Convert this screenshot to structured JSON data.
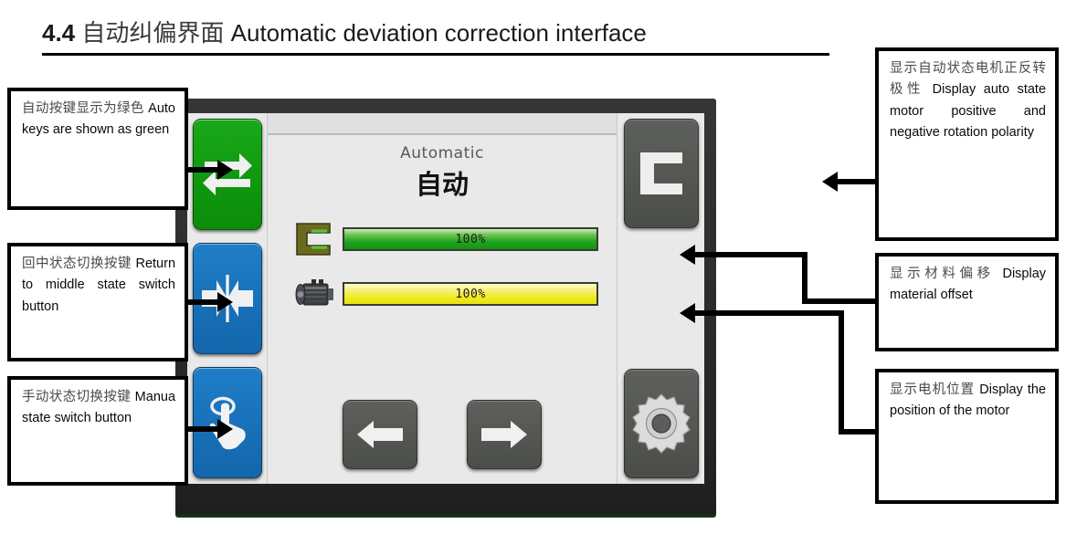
{
  "heading": {
    "number": "4.4",
    "chinese": "自动纠偏界面",
    "english": "Automatic deviation correction interface"
  },
  "hmi": {
    "mode_title_en": "Automatic",
    "mode_title_cn": "自动",
    "gauges": [
      {
        "icon": "fork-sensor-icon",
        "value": "100%",
        "color": "#1fa520",
        "name": "material-offset-gauge"
      },
      {
        "icon": "servo-motor-icon",
        "value": "100%",
        "color": "#eeea1c",
        "name": "motor-position-gauge"
      }
    ],
    "left_buttons": [
      {
        "name": "auto-mode-button",
        "icon": "cycle-arrows-icon",
        "color": "#10980f"
      },
      {
        "name": "return-middle-button",
        "icon": "center-arrows-icon",
        "color": "#1870b8"
      },
      {
        "name": "manual-mode-button",
        "icon": "touch-hand-icon",
        "color": "#1870b8"
      }
    ],
    "right_buttons": [
      {
        "name": "sensor-polarity-button",
        "icon": "fork-sensor-icon",
        "color": "#555753"
      },
      {
        "name": "settings-button",
        "icon": "gear-icon",
        "color": "#555753"
      }
    ],
    "jog_buttons": [
      {
        "name": "jog-left-button",
        "icon": "arrow-left-icon"
      },
      {
        "name": "jog-right-button",
        "icon": "arrow-right-icon"
      }
    ]
  },
  "annotations": {
    "auto_key": {
      "cn": "自动按键显示为绿色",
      "en": "Auto keys are shown as green"
    },
    "return_middle": {
      "cn": "回中状态切换按键",
      "en": "Return to middle state switch button"
    },
    "manual": {
      "cn": "手动状态切换按键",
      "en": "Manua state switch button"
    },
    "polarity": {
      "cn": "显示自动状态电机正反转极性",
      "en": "Display auto state motor positive and negative rotation polarity"
    },
    "offset": {
      "cn": "显示材料偏移",
      "en": "Display material offset"
    },
    "motor_position": {
      "cn": "显示电机位置",
      "en": "Display the position of the motor"
    }
  }
}
